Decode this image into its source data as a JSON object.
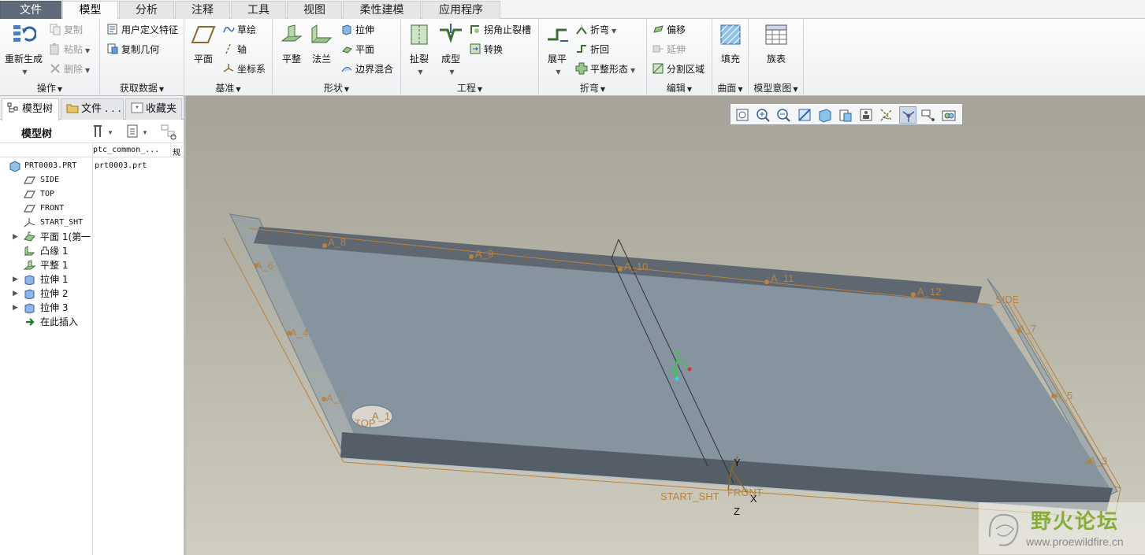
{
  "menu": {
    "tabs": [
      "文件",
      "模型",
      "分析",
      "注释",
      "工具",
      "视图",
      "柔性建模",
      "应用程序"
    ],
    "active": "模型"
  },
  "ribbon": {
    "ops": {
      "regen": "重新生成",
      "copy": "复制",
      "paste": "粘贴",
      "delete": "删除",
      "label": "操作"
    },
    "getdata": {
      "udf": "用户定义特征",
      "copygeom": "复制几何",
      "label": "获取数据"
    },
    "datum": {
      "plane": "平面",
      "sketch": "草绘",
      "axis": "轴",
      "csys": "坐标系",
      "label": "基准"
    },
    "shapes": {
      "flat": "平整",
      "flange": "法兰",
      "extrude": "拉伸",
      "planar": "平面",
      "blend": "边界混合",
      "label": "形状"
    },
    "eng": {
      "rip": "扯裂",
      "form": "成型",
      "corner_relief": "拐角止裂槽",
      "convert": "转换",
      "label": "工程"
    },
    "bend": {
      "unbend": "展平",
      "bend": "折弯",
      "bendback": "折回",
      "flat_pattern": "平整形态",
      "label": "折弯"
    },
    "edit": {
      "offset": "偏移",
      "extend": "延伸",
      "split": "分割区域",
      "label": "编辑"
    },
    "surface": {
      "fill": "填充",
      "label": "曲面"
    },
    "intent": {
      "table": "族表",
      "label": "模型意图"
    }
  },
  "panel": {
    "tabs": [
      "模型树",
      "文件 . . .",
      "收藏夹"
    ],
    "tree_title": "模型树",
    "col1": "ptc_common_...",
    "col2": "规",
    "items": [
      {
        "name": "PRT0003.PRT",
        "value": "prt0003.prt",
        "icon": "part-icon",
        "expandable": false,
        "indent": 0,
        "mono": true
      },
      {
        "name": "SIDE",
        "value": "",
        "icon": "datum-plane-icon",
        "expandable": false,
        "indent": 1,
        "mono": true
      },
      {
        "name": "TOP",
        "value": "",
        "icon": "datum-plane-icon",
        "expandable": false,
        "indent": 1,
        "mono": true
      },
      {
        "name": "FRONT",
        "value": "",
        "icon": "datum-plane-icon",
        "expandable": false,
        "indent": 1,
        "mono": true
      },
      {
        "name": "START_SHT",
        "value": "",
        "icon": "csys-icon",
        "expandable": false,
        "indent": 1,
        "mono": true
      },
      {
        "name": "平面 1(第一",
        "value": "",
        "icon": "flat-wall-icon",
        "expandable": true,
        "indent": 1,
        "mono": false
      },
      {
        "name": "凸缘 1",
        "value": "",
        "icon": "flange-icon",
        "expandable": false,
        "indent": 1,
        "mono": false
      },
      {
        "name": "平整 1",
        "value": "",
        "icon": "flat-icon",
        "expandable": false,
        "indent": 1,
        "mono": false
      },
      {
        "name": "拉伸 1",
        "value": "",
        "icon": "extrude-icon",
        "expandable": true,
        "indent": 1,
        "mono": false
      },
      {
        "name": "拉伸 2",
        "value": "",
        "icon": "extrude-icon",
        "expandable": true,
        "indent": 1,
        "mono": false
      },
      {
        "name": "拉伸 3",
        "value": "",
        "icon": "extrude-icon",
        "expandable": true,
        "indent": 1,
        "mono": false
      },
      {
        "name": "在此插入",
        "value": "",
        "icon": "insert-here-icon",
        "expandable": false,
        "indent": 1,
        "mono": false
      }
    ]
  },
  "viewport": {
    "annotations": [
      "A_8",
      "A_9",
      "A_10",
      "A_11",
      "A_12",
      "A_6",
      "A_4",
      "A_2",
      "A_1",
      "A_7",
      "A_5",
      "A_3"
    ],
    "datums": [
      "SIDE",
      "TOP",
      "FRONT",
      "START_SHT"
    ],
    "axes": [
      "Y",
      "X",
      "Z"
    ],
    "toolbar_icons": [
      "refit-icon",
      "zoom-in-icon",
      "zoom-out-icon",
      "repaint-icon",
      "display-style-icon",
      "saved-views-icon",
      "view-manager-icon",
      "datum-display-icon",
      "spin-center-icon",
      "annotation-display-icon",
      "appearance-icon"
    ],
    "watermark_title": "野火论坛",
    "watermark_url": "www.proewildfire.cn"
  }
}
